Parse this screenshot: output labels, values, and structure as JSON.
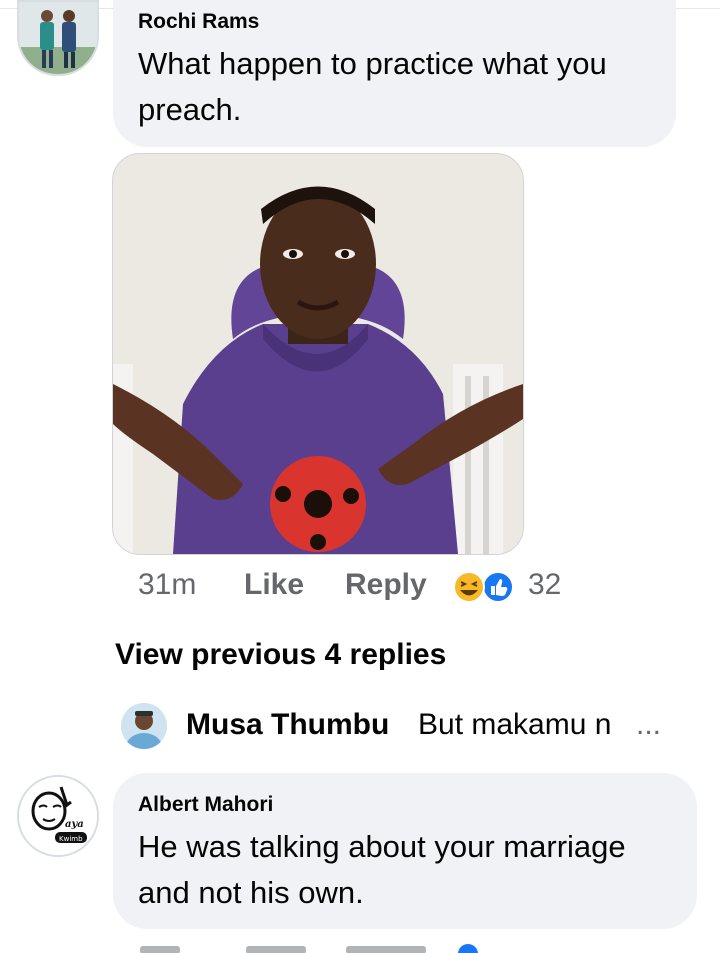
{
  "comments": [
    {
      "author": "Rochi Rams",
      "text": "What happen to practice what you preach."
    },
    {
      "author": "Albert Mahori",
      "text": "He was talking about your marriage and not his own.",
      "avatar_text": "Mena aya Kwimbi"
    }
  ],
  "actions": {
    "time": "31m",
    "like": "Like",
    "reply": "Reply",
    "reaction_count": "32",
    "reaction_icons": [
      "haha-emoji-icon",
      "like-thumb-icon"
    ]
  },
  "view_previous": "View previous 4 replies",
  "reply_preview": {
    "author": "Musa Thumbu",
    "text": "But makamu n",
    "ellipsis": "..."
  },
  "colors": {
    "bubble": "#f0f2f5",
    "secondary_text": "#65676b",
    "like_blue": "#1877f2",
    "haha_yellow": "#f7b928"
  }
}
